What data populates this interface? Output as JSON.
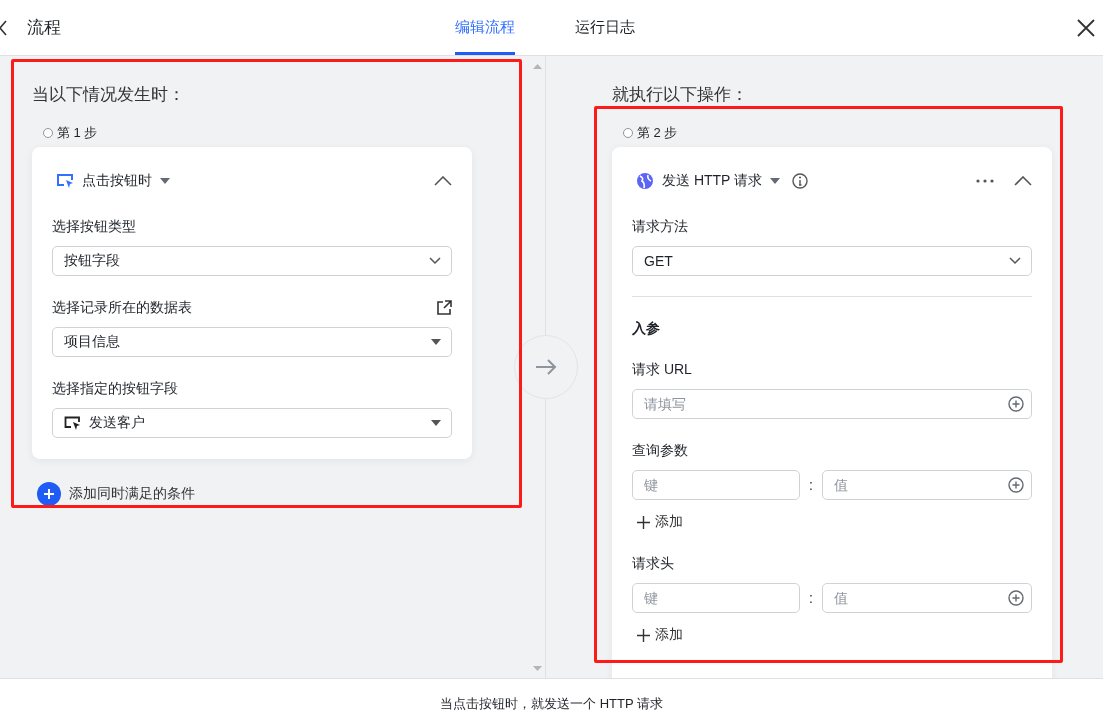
{
  "header": {
    "title": "流程",
    "tabs": [
      {
        "label": "编辑流程",
        "selected": true
      },
      {
        "label": "运行日志",
        "selected": false
      }
    ]
  },
  "trigger": {
    "heading": "当以下情况发生时：",
    "step": "第 1 步",
    "card_title": "点击按钮时",
    "fields": [
      {
        "label": "选择按钮类型",
        "value": "按钮字段",
        "kind": "chevron"
      },
      {
        "label": "选择记录所在的数据表",
        "value": "项目信息",
        "kind": "caret"
      },
      {
        "label": "选择指定的按钮字段",
        "value": "发送客户",
        "kind": "caret"
      }
    ],
    "add_condition": "添加同时满足的条件"
  },
  "action": {
    "heading": "就执行以下操作：",
    "step": "第 2 步",
    "card_title": "发送 HTTP 请求",
    "method": {
      "label": "请求方法",
      "value": "GET"
    },
    "section": "入参",
    "url": {
      "label": "请求 URL",
      "placeholder": "请填写"
    },
    "pairs": [
      {
        "label": "查询参数",
        "key_placeholder": "键",
        "separator": ":",
        "value_placeholder": "值",
        "add": "添加"
      },
      {
        "label": "请求头",
        "key_placeholder": "键",
        "separator": ":",
        "value_placeholder": "值",
        "add": "添加"
      }
    ]
  },
  "footer": "当点击按钮时，就发送一个 HTTP 请求",
  "highlight_frames": [
    {
      "kind": "rectangle"
    },
    {
      "kind": "rectangle"
    }
  ]
}
